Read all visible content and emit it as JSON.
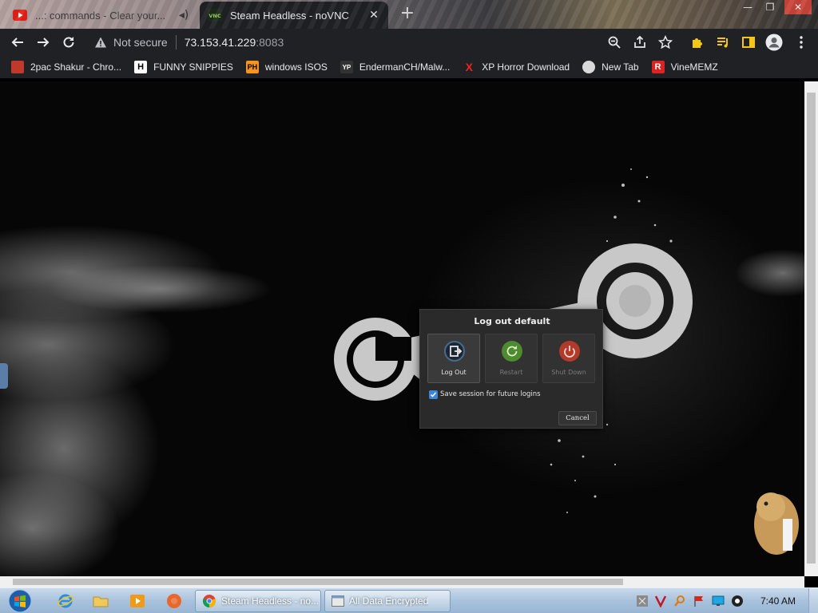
{
  "browser": {
    "tabs": [
      {
        "title": "...: commands - Clear your...",
        "active": false
      },
      {
        "title": "Steam Headless - noVNC",
        "active": true
      }
    ],
    "address": {
      "security_label": "Not secure",
      "host": "73.153.41.229",
      "port": ":8083"
    },
    "bookmarks": [
      {
        "label": "2pac Shakur - Chro...",
        "icon": "bookmark-2pac-icon"
      },
      {
        "label": "FUNNY SNIPPIES",
        "icon": "bookmark-h-icon",
        "glyph": "H"
      },
      {
        "label": "windows ISOS",
        "icon": "bookmark-ph-icon",
        "glyph": "PH"
      },
      {
        "label": "EndermanCH/Malw...",
        "icon": "bookmark-yp-icon",
        "glyph": "YP"
      },
      {
        "label": "XP Horror Download",
        "icon": "bookmark-x-icon",
        "glyph": "X"
      },
      {
        "label": "New Tab",
        "icon": "bookmark-newtab-icon"
      },
      {
        "label": "VineMEMZ",
        "icon": "bookmark-r-icon",
        "glyph": "R"
      }
    ]
  },
  "dialog": {
    "title": "Log out default",
    "options": [
      {
        "label": "Log Out",
        "enabled": true,
        "color": "#4a6a8c"
      },
      {
        "label": "Restart",
        "enabled": false,
        "color": "#4e8a2e"
      },
      {
        "label": "Shut Down",
        "enabled": false,
        "color": "#b23a2a"
      }
    ],
    "save_session": {
      "label": "Save session for future logins",
      "checked": true
    },
    "cancel_label": "Cancel"
  },
  "taskbar": {
    "tasks": [
      {
        "label": "Steam Headless - no...",
        "icon": "chrome-icon"
      },
      {
        "label": "All Data Encrypted",
        "icon": "window-icon"
      }
    ],
    "clock": "7:40 AM"
  },
  "colors": {
    "accent": "#3d85d6",
    "chrome_bg": "#202124"
  }
}
